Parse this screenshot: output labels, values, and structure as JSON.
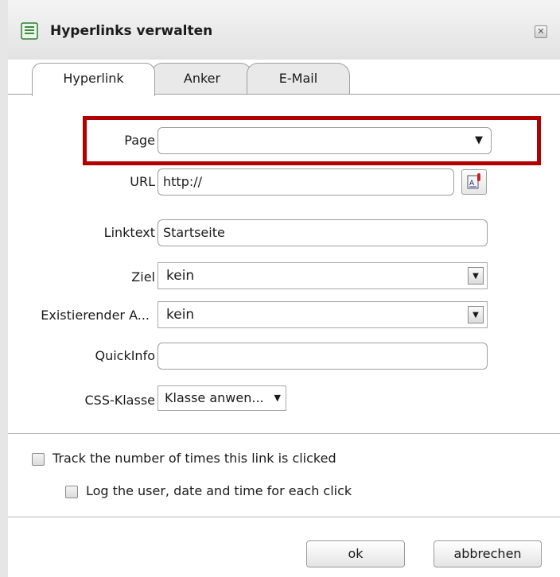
{
  "dialog": {
    "title": "Hyperlinks verwalten",
    "close_icon": "close-icon"
  },
  "tabs": [
    {
      "label": "Hyperlink",
      "active": true
    },
    {
      "label": "Anker",
      "active": false
    },
    {
      "label": "E-Mail",
      "active": false
    }
  ],
  "form": {
    "page": {
      "label": "Page",
      "value": ""
    },
    "url": {
      "label": "URL",
      "value": "http://"
    },
    "linktext": {
      "label": "Linktext",
      "value": "Startseite"
    },
    "ziel": {
      "label": "Ziel",
      "value": "kein"
    },
    "existing_anchor": {
      "label": "Existierender A...",
      "value": "kein"
    },
    "quickinfo": {
      "label": "QuickInfo",
      "value": ""
    },
    "css_class": {
      "label": "CSS-Klasse",
      "value": "Klasse anwen..."
    }
  },
  "tracking": {
    "track_clicks": {
      "label": "Track the number of times this link is clicked",
      "checked": false
    },
    "log_user": {
      "label": "Log the user, date and time for each click",
      "checked": false
    }
  },
  "buttons": {
    "ok": "ok",
    "cancel": "abbrechen"
  },
  "colors": {
    "highlight": "#b00000"
  }
}
